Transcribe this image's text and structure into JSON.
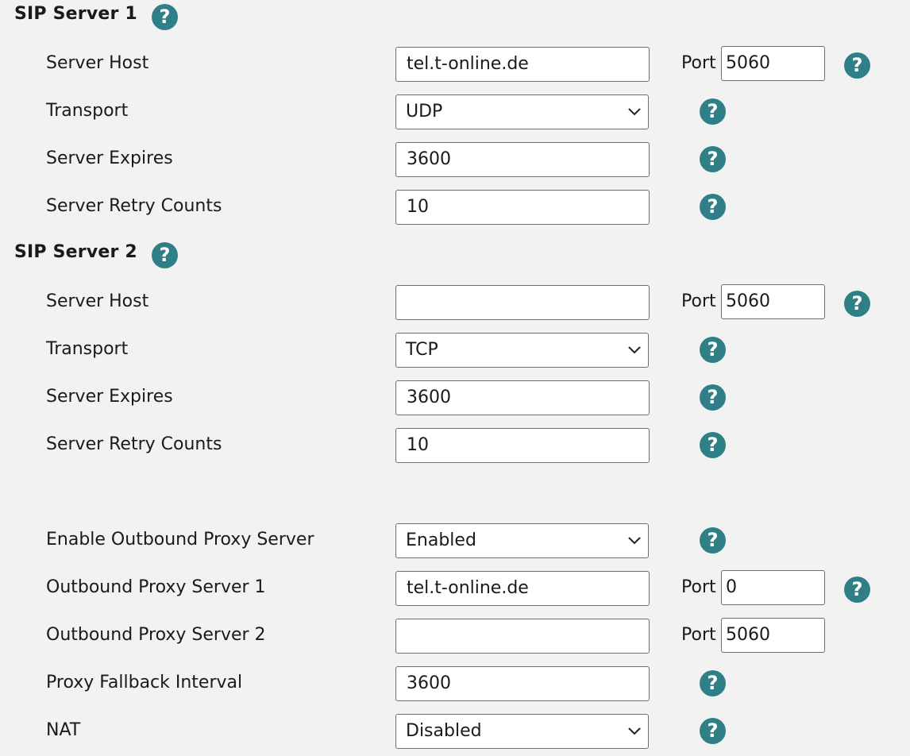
{
  "sip_server_1": {
    "title": "SIP Server 1",
    "server_host_label": "Server Host",
    "server_host_value": "tel.t-online.de",
    "port_label": "Port",
    "port_value": "5060",
    "transport_label": "Transport",
    "transport_value": "UDP",
    "server_expires_label": "Server Expires",
    "server_expires_value": "3600",
    "server_retry_label": "Server Retry Counts",
    "server_retry_value": "10"
  },
  "sip_server_2": {
    "title": "SIP Server 2",
    "server_host_label": "Server Host",
    "server_host_value": "",
    "port_label": "Port",
    "port_value": "5060",
    "transport_label": "Transport",
    "transport_value": "TCP",
    "server_expires_label": "Server Expires",
    "server_expires_value": "3600",
    "server_retry_label": "Server Retry Counts",
    "server_retry_value": "10"
  },
  "proxy": {
    "enable_label": "Enable Outbound Proxy Server",
    "enable_value": "Enabled",
    "server1_label": "Outbound Proxy Server 1",
    "server1_value": "tel.t-online.de",
    "server1_port_label": "Port",
    "server1_port_value": "0",
    "server2_label": "Outbound Proxy Server 2",
    "server2_value": "",
    "server2_port_label": "Port",
    "server2_port_value": "5060",
    "fallback_label": "Proxy Fallback Interval",
    "fallback_value": "3600",
    "nat_label": "NAT",
    "nat_value": "Disabled"
  },
  "help_glyph": "?",
  "icons": {
    "help": "help-icon",
    "dropdown": "chevron-down-icon"
  },
  "colors": {
    "help_icon": "#2f7f86",
    "background": "#f2f2f2",
    "field_border": "#6e6e6e"
  }
}
